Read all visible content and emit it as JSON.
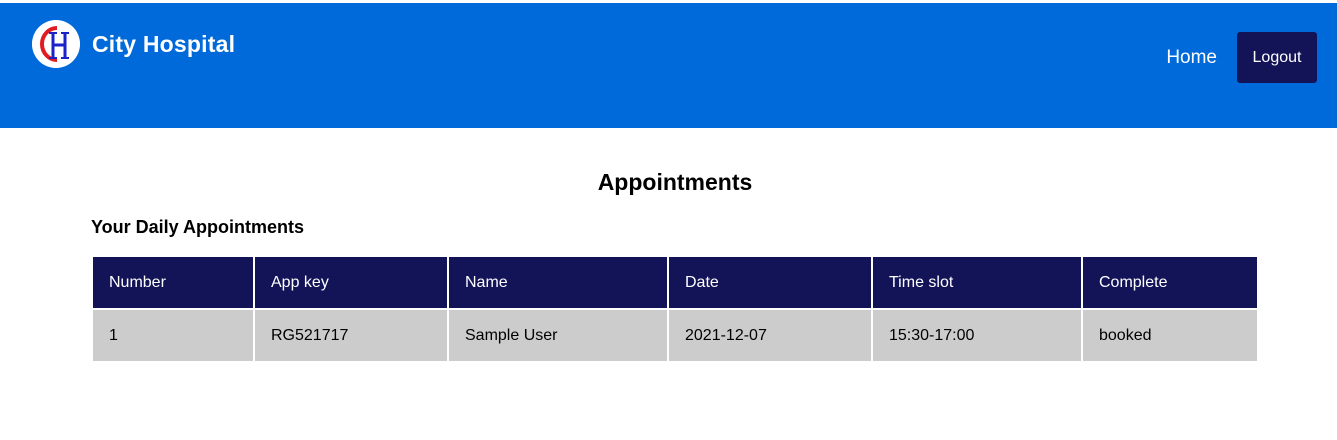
{
  "header": {
    "brand_name": "City Hospital",
    "logo_icon": "city-hospital-logo",
    "nav_home": "Home",
    "logout_label": "Logout"
  },
  "colors": {
    "header_bg": "#006adb",
    "table_header_bg": "#131458",
    "table_row_bg": "#cccccc"
  },
  "page": {
    "title": "Appointments",
    "subtitle": "Your Daily Appointments"
  },
  "table": {
    "columns": [
      "Number",
      "App key",
      "Name",
      "Date",
      "Time slot",
      "Complete"
    ],
    "rows": [
      [
        "1",
        "RG521717",
        "Sample User",
        "2021-12-07",
        "15:30-17:00",
        "booked"
      ]
    ]
  }
}
